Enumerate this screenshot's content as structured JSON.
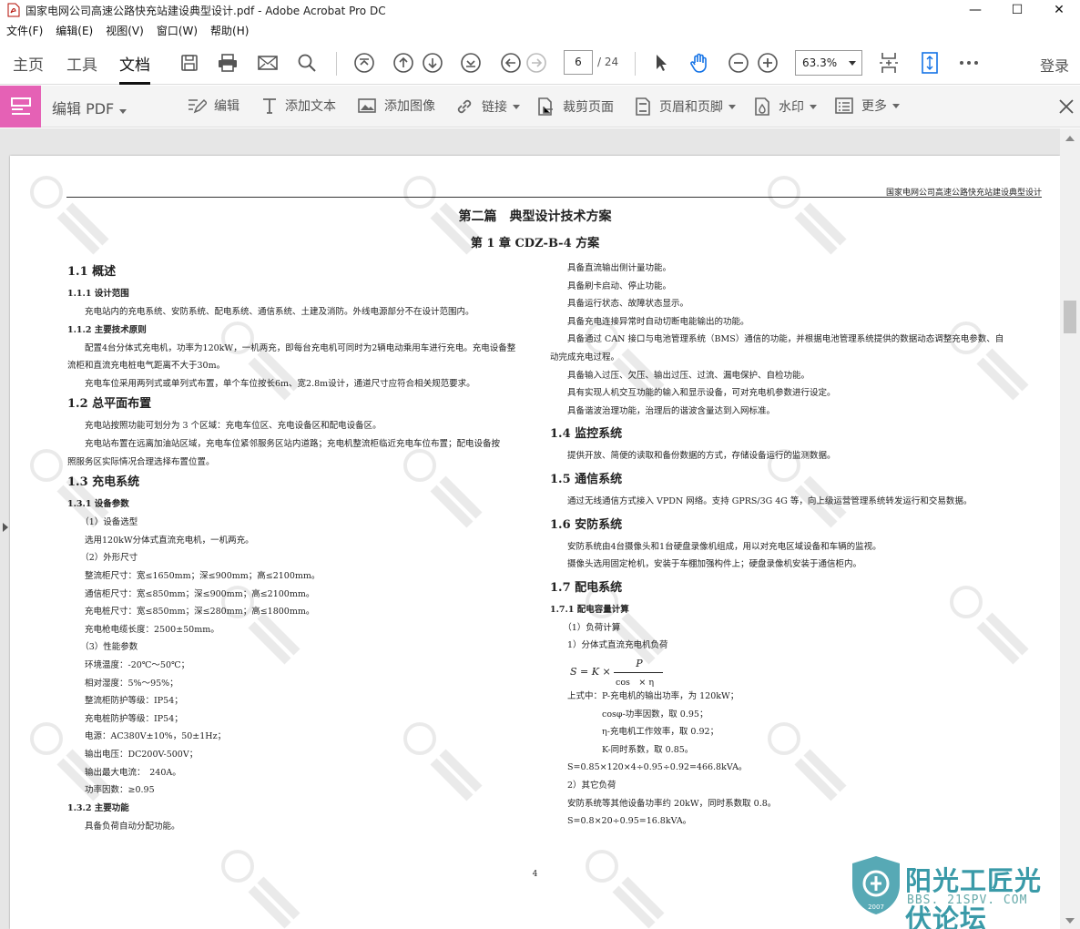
{
  "window": {
    "title": "国家电网公司高速公路快充站建设典型设计.pdf - Adobe Acrobat Pro DC",
    "controls": [
      "—",
      "☐",
      "✕"
    ]
  },
  "menu": [
    "文件(F)",
    "编辑(E)",
    "视图(V)",
    "窗口(W)",
    "帮助(H)"
  ],
  "toolbar": {
    "tabs": [
      "主页",
      "工具",
      "文档"
    ],
    "active_tab": "文档",
    "page_current": "6",
    "page_total": "/ 24",
    "zoom": "63.3%",
    "login": "登录"
  },
  "editbar": {
    "label": "编辑 PDF",
    "items": [
      "编辑",
      "添加文本",
      "添加图像",
      "链接",
      "裁剪页面",
      "页眉和页脚",
      "水印",
      "更多"
    ]
  },
  "document": {
    "running_head": "国家电网公司高速公路快充站建设典型设计",
    "part_title": "第二篇　典型设计技术方案",
    "chapter_title": "第 1 章 CDZ-B-4 方案",
    "page_number": "4",
    "left_column": [
      {
        "t": "h2",
        "text": "1.1 概述"
      },
      {
        "t": "h3",
        "text": "1.1.1 设计范围"
      },
      {
        "t": "p",
        "text": "　　充电站内的充电系统、安防系统、配电系统、通信系统、土建及消防。外线电源部分不在设计范围内。"
      },
      {
        "t": "h3",
        "text": "1.1.2 主要技术原则"
      },
      {
        "t": "p",
        "text": "　　配置4台分体式充电机，功率为120kW，一机两充，即每台充电机可同时为2辆电动乘用车进行充电。充电设备整"
      },
      {
        "t": "p0",
        "text": "流柜和直流充电桩电气距离不大于30m。"
      },
      {
        "t": "p",
        "text": "　　充电车位采用两列式或单列式布置，单个车位按长6m、宽2.8m设计，通道尺寸应符合相关规范要求。"
      },
      {
        "t": "h2",
        "text": "1.2 总平面布置"
      },
      {
        "t": "p",
        "text": "　　充电站按照功能可划分为 3 个区域：充电车位区、充电设备区和配电设备区。"
      },
      {
        "t": "p",
        "text": "　　充电站布置在远离加油站区域，充电车位紧邻服务区站内道路；充电机整流柜临近充电车位布置；配电设备按"
      },
      {
        "t": "p0",
        "text": "照服务区实际情况合理选择布置位置。"
      },
      {
        "t": "h2",
        "text": "1.3 充电系统"
      },
      {
        "t": "h3",
        "text": "1.3.1 设备参数"
      },
      {
        "t": "p",
        "text": "　　（1）设备选型"
      },
      {
        "t": "p",
        "text": "　　选用120kW分体式直流充电机，一机两充。"
      },
      {
        "t": "p",
        "text": "　　（2）外形尺寸"
      },
      {
        "t": "p",
        "text": "　　整流柜尺寸：宽≤1650mm；深≤900mm；高≤2100mm。"
      },
      {
        "t": "p",
        "text": "　　通信柜尺寸：宽≤850mm；深≤900mm；高≤2100mm。"
      },
      {
        "t": "p",
        "text": "　　充电桩尺寸：宽≤850mm；深≤280mm；高≤1800mm。"
      },
      {
        "t": "p",
        "text": "　　充电枪电缆长度：2500±50mm。"
      },
      {
        "t": "p",
        "text": "　　（3）性能参数"
      },
      {
        "t": "p",
        "text": "　　环境温度：-20℃～50℃；"
      },
      {
        "t": "p",
        "text": "　　相对湿度：5%～95%；"
      },
      {
        "t": "p",
        "text": "　　整流柜防护等级：IP54；"
      },
      {
        "t": "p",
        "text": "　　充电桩防护等级：IP54；"
      },
      {
        "t": "p",
        "text": "　　电源：AC380V±10%，50±1Hz；"
      },
      {
        "t": "p",
        "text": "　　输出电压：DC200V-500V；"
      },
      {
        "t": "p",
        "text": "　　输出最大电流：　240A。"
      },
      {
        "t": "p",
        "text": "　　功率因数：≥0.95"
      },
      {
        "t": "h3",
        "text": "1.3.2 主要功能"
      },
      {
        "t": "p",
        "text": "　　具备负荷自动分配功能。"
      }
    ],
    "right_column": [
      {
        "t": "p",
        "text": "　　具备直流输出侧计量功能。"
      },
      {
        "t": "p",
        "text": "　　具备刷卡启动、停止功能。"
      },
      {
        "t": "p",
        "text": "　　具备运行状态、故障状态显示。"
      },
      {
        "t": "p",
        "text": "　　具备充电连接异常时自动切断电能输出的功能。"
      },
      {
        "t": "p",
        "text": "　　具备通过 CAN 接口与电池管理系统（BMS）通信的功能，并根据电池管理系统提供的数据动态调整充电参数、自"
      },
      {
        "t": "p0",
        "text": "动完成充电过程。"
      },
      {
        "t": "p",
        "text": "　　具备输入过压、欠压、输出过压、过流、漏电保护、自检功能。"
      },
      {
        "t": "p",
        "text": "　　具有实现人机交互功能的输入和显示设备，可对充电机参数进行设定。"
      },
      {
        "t": "p",
        "text": "　　具备谐波治理功能，治理后的谐波含量达到入网标准。"
      },
      {
        "t": "h2",
        "text": "1.4 监控系统"
      },
      {
        "t": "p",
        "text": "　　提供开放、简便的读取和备份数据的方式，存储设备运行的监测数据。"
      },
      {
        "t": "h2",
        "text": "1.5 通信系统"
      },
      {
        "t": "p",
        "text": "　　通过无线通信方式接入 VPDN 网络。支持 GPRS/3G 4G 等，向上级运营管理系统转发运行和交易数据。"
      },
      {
        "t": "h2",
        "text": "1.6 安防系统"
      },
      {
        "t": "p",
        "text": "　　安防系统由4台摄像头和1台硬盘录像机组成，用以对充电区域设备和车辆的监视。"
      },
      {
        "t": "p",
        "text": "　　摄像头选用固定枪机，安装于车棚加强构件上；硬盘录像机安装于通信柜内。"
      },
      {
        "t": "h2",
        "text": "1.7 配电系统"
      },
      {
        "t": "h3",
        "text": "1.7.1 配电容量计算"
      },
      {
        "t": "p",
        "text": "　　（1）负荷计算"
      },
      {
        "t": "p",
        "text": "　　1）分体式直流充电机负荷"
      },
      {
        "t": "formula",
        "text": ""
      },
      {
        "t": "p",
        "text": "　　上式中：P-充电机的输出功率，为 120kW；"
      },
      {
        "t": "p",
        "text": "　　　　　　cosφ-功率因数，取 0.95；"
      },
      {
        "t": "p",
        "text": "　　　　　　η-充电机工作效率，取 0.92；"
      },
      {
        "t": "p",
        "text": "　　　　　　K-同时系数，取 0.85。"
      },
      {
        "t": "p",
        "text": "　　S=0.85×120×4÷0.95÷0.92=466.8kVA。"
      },
      {
        "t": "p",
        "text": "　　2）其它负荷"
      },
      {
        "t": "p",
        "text": "　　安防系统等其他设备功率约 20kW，同时系数取 0.8。"
      },
      {
        "t": "p",
        "text": "　　S=0.8×20÷0.95=16.8kVA。"
      }
    ],
    "formula": {
      "lhs": "S = K ×",
      "num": "P",
      "den": "cos　× η"
    }
  },
  "logo": {
    "name": "阳光工匠光伏论坛",
    "url": "BBS. 21SPV. COM",
    "year": "2007"
  },
  "colors": {
    "accent_pink": "#e561b5",
    "logo_teal": "#3a9aa8"
  }
}
